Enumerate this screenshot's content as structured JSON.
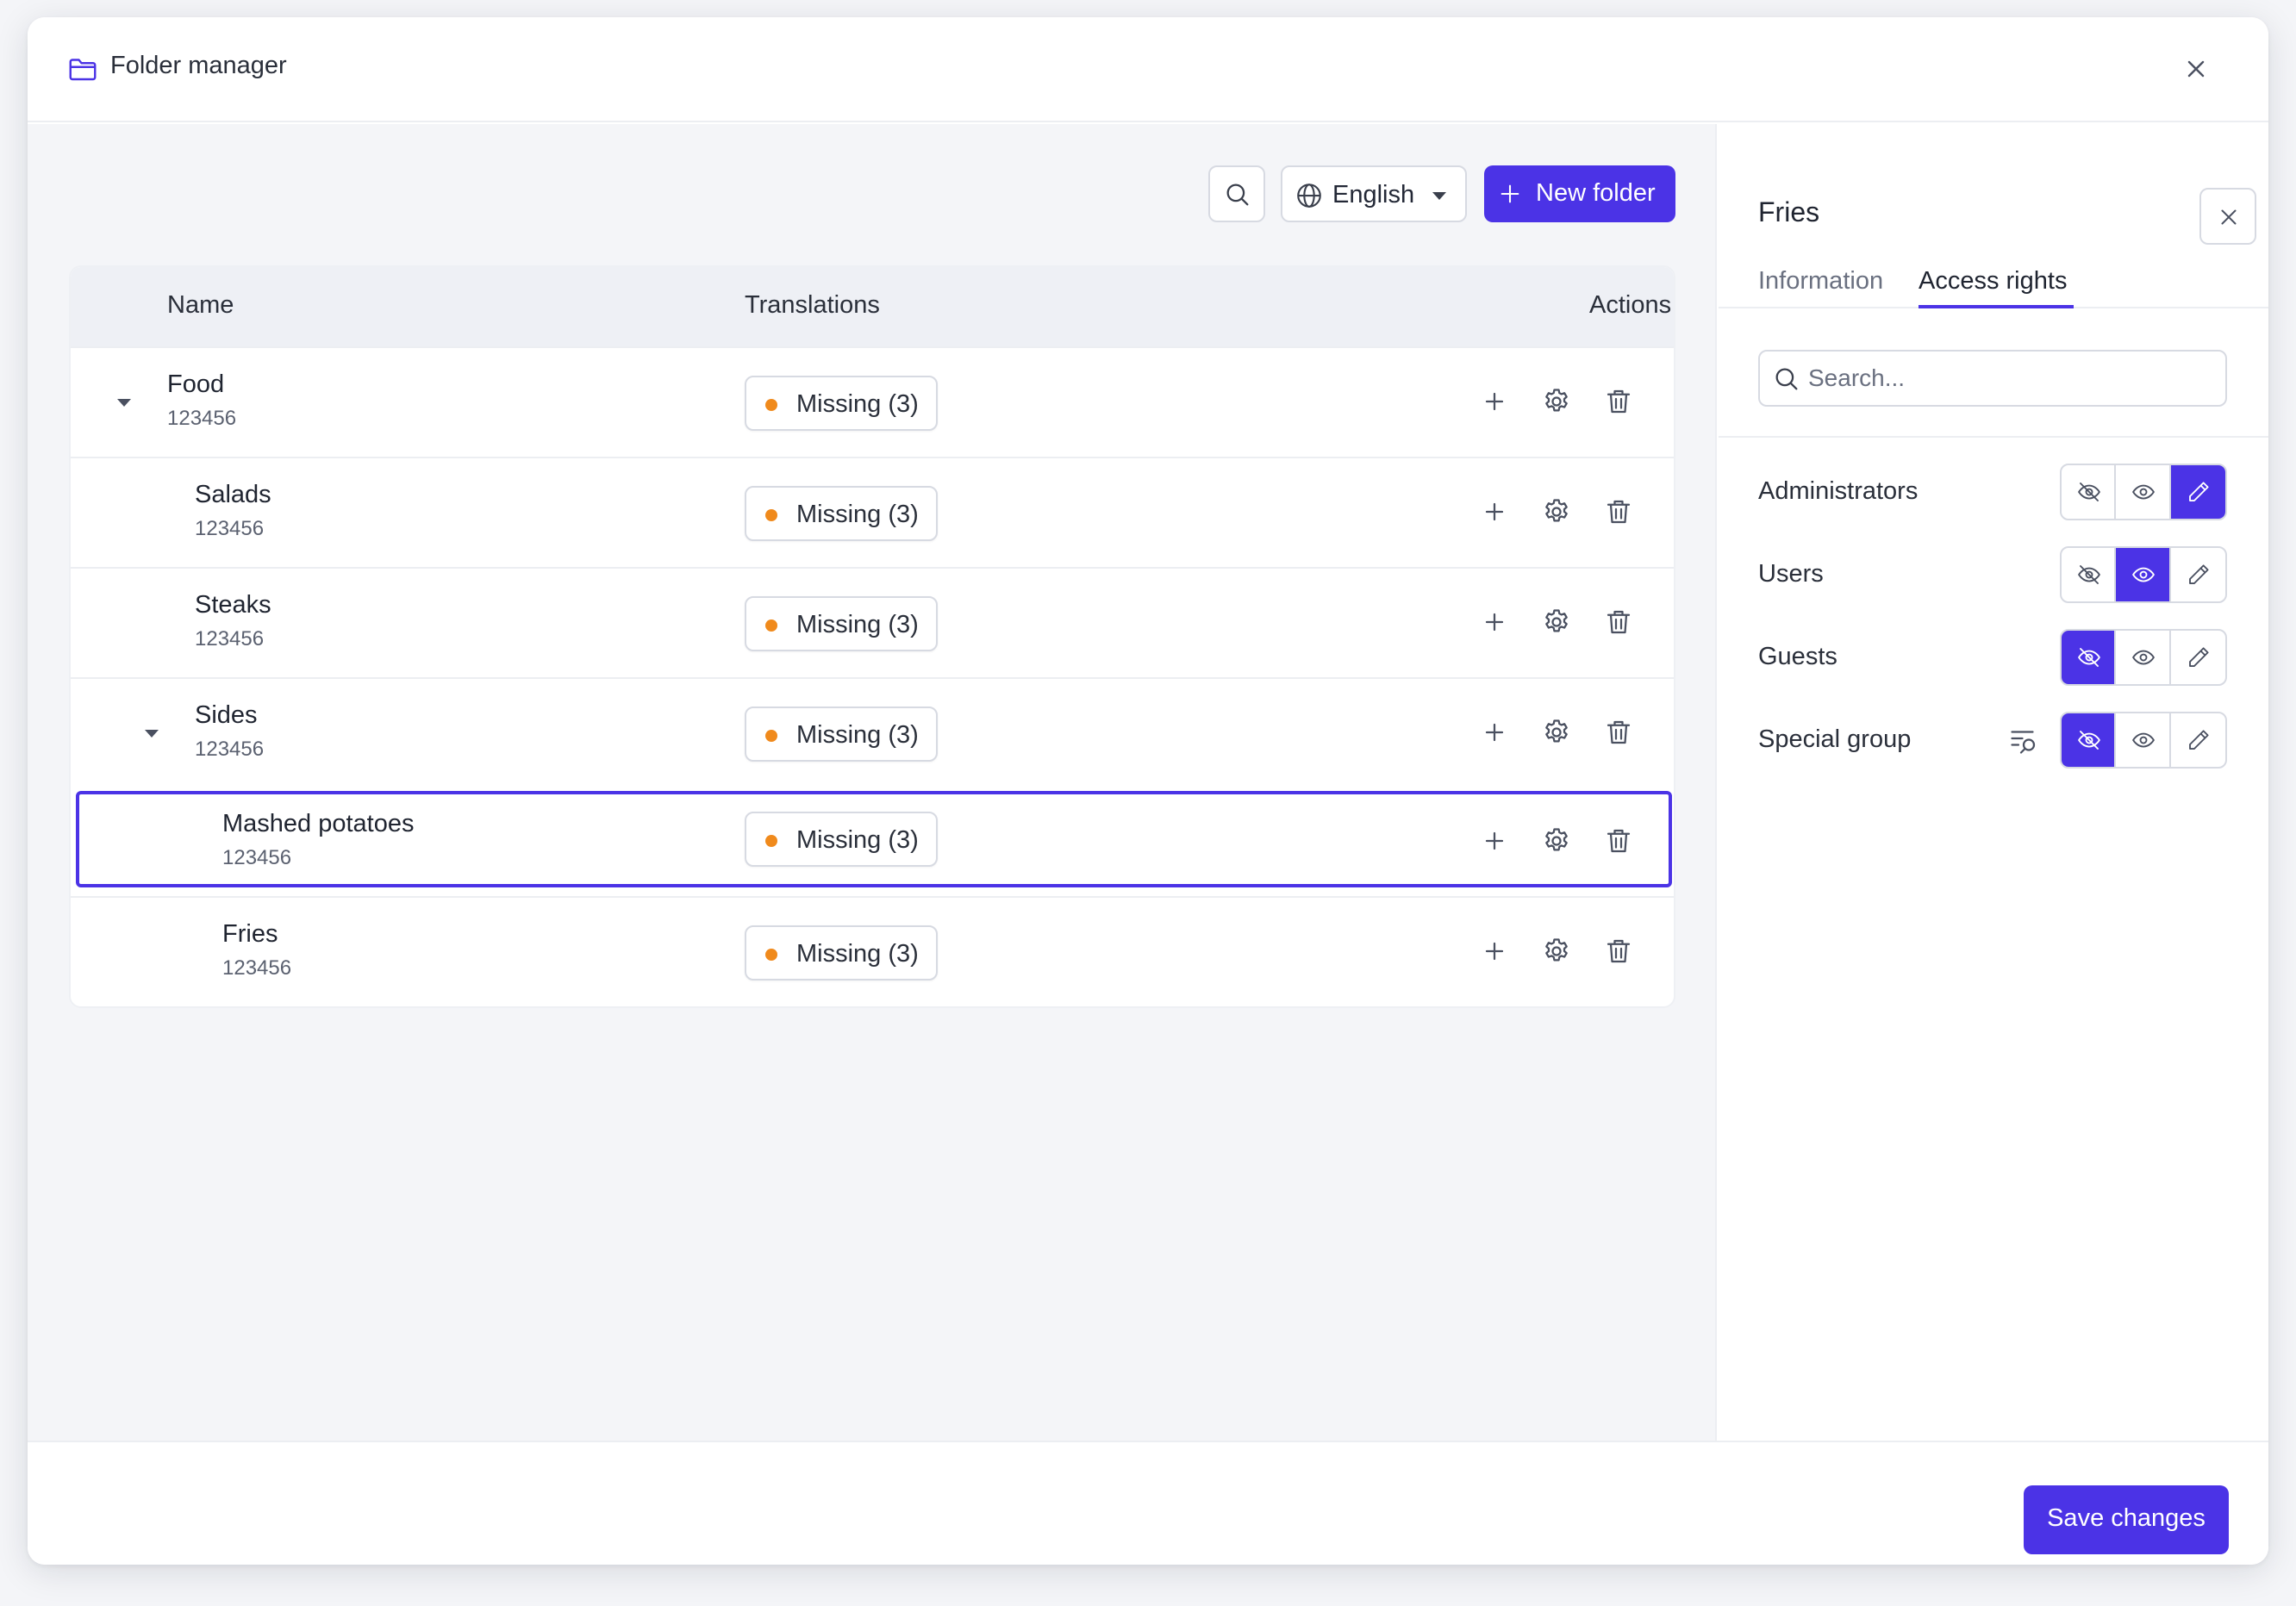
{
  "window": {
    "title": "Folder manager"
  },
  "toolbar": {
    "language": "English",
    "new_folder_label": "New folder"
  },
  "table": {
    "columns": {
      "name": "Name",
      "translations": "Translations",
      "actions": "Actions"
    },
    "rows": [
      {
        "name": "Food",
        "id": "123456",
        "translation": "Missing (3)",
        "expanded": true
      },
      {
        "name": "Salads",
        "id": "123456",
        "translation": "Missing (3)"
      },
      {
        "name": "Steaks",
        "id": "123456",
        "translation": "Missing (3)"
      },
      {
        "name": "Sides",
        "id": "123456",
        "translation": "Missing (3)",
        "expanded": true
      },
      {
        "name": "Mashed potatoes",
        "id": "123456",
        "translation": "Missing (3)",
        "selected": true
      },
      {
        "name": "Fries",
        "id": "123456",
        "translation": "Missing (3)"
      }
    ]
  },
  "side": {
    "title": "Fries",
    "tabs": {
      "information": "Information",
      "access_rights": "Access rights"
    },
    "active_tab": "Access rights",
    "search_placeholder": "Search...",
    "groups": [
      {
        "label": "Administrators",
        "access": "edit"
      },
      {
        "label": "Users",
        "access": "view"
      },
      {
        "label": "Guests",
        "access": "hidden"
      },
      {
        "label": "Special group",
        "access": "hidden",
        "filter_icon": true
      }
    ]
  },
  "footer": {
    "save_label": "Save changes"
  },
  "colors": {
    "accent": "#4b33e6",
    "warning_dot": "#f08a1c"
  }
}
